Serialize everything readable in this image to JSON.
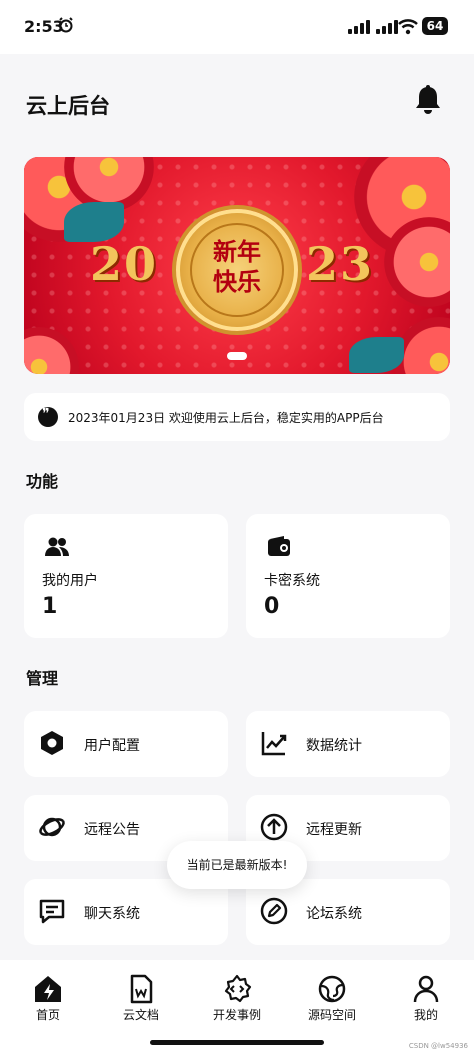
{
  "status_bar": {
    "time": "2:53",
    "battery": "64"
  },
  "header": {
    "title": "云上后台"
  },
  "notice": {
    "text": "2023年01月23日  欢迎使用云上后台，稳定实用的APP后台"
  },
  "banner": {
    "left_digits": "20",
    "right_digits": "23",
    "line1": "新年",
    "line2": "快乐"
  },
  "sections": {
    "functions": "功能",
    "management": "管理"
  },
  "stats": [
    {
      "label": "我的用户",
      "value": "1",
      "icon": "users-icon"
    },
    {
      "label": "卡密系统",
      "value": "0",
      "icon": "wallet-icon"
    }
  ],
  "tiles": [
    {
      "label": "用户配置",
      "icon": "hexagon-settings-icon"
    },
    {
      "label": "数据统计",
      "icon": "chart-line-icon"
    },
    {
      "label": "远程公告",
      "icon": "planet-icon"
    },
    {
      "label": "远程更新",
      "icon": "arrow-up-circle-icon"
    },
    {
      "label": "聊天系统",
      "icon": "chat-icon"
    },
    {
      "label": "论坛系统",
      "icon": "edit-circle-icon"
    }
  ],
  "toast": {
    "text": "当前已是最新版本!"
  },
  "tabbar": [
    {
      "label": "首页",
      "icon": "home-icon"
    },
    {
      "label": "云文档",
      "icon": "document-icon"
    },
    {
      "label": "开发事例",
      "icon": "code-gear-icon"
    },
    {
      "label": "源码空间",
      "icon": "globe-icon"
    },
    {
      "label": "我的",
      "icon": "user-icon"
    }
  ],
  "watermark": "CSDN @lw54936"
}
